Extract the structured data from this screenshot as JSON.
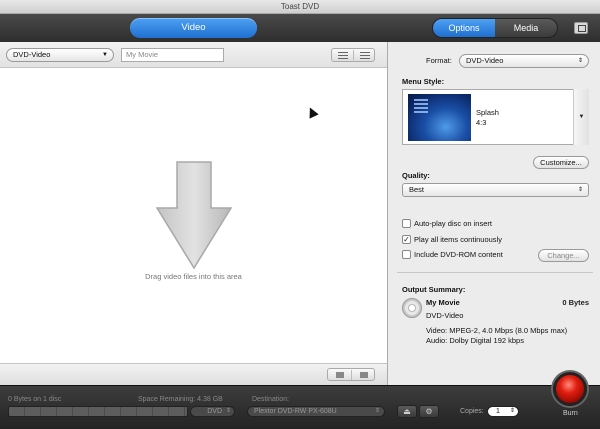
{
  "window": {
    "title": "Toast DVD"
  },
  "toolbar": {
    "video_label": "Video",
    "tabs": [
      {
        "label": "Options"
      },
      {
        "label": "Media"
      }
    ],
    "active_tab": "Options"
  },
  "left": {
    "format_select": "DVD-Video",
    "title_placeholder": "My Movie",
    "drop_hint": "Drag video files into this area"
  },
  "options": {
    "format_label": "Format:",
    "format_value": "DVD-Video",
    "menu_style_label": "Menu Style:",
    "menu_style_name": "Splash",
    "menu_style_ratio": "4:3",
    "customize_label": "Customize...",
    "quality_label": "Quality:",
    "quality_value": "Best",
    "checkboxes": [
      {
        "label": "Auto-play disc on insert",
        "checked": false
      },
      {
        "label": "Play all items continuously",
        "checked": true
      },
      {
        "label": "Include DVD-ROM content",
        "checked": false
      }
    ],
    "change_label": "Change...",
    "summary_label": "Output Summary:",
    "summary_name": "My Movie",
    "summary_size": "0 Bytes",
    "summary_format": "DVD-Video",
    "summary_video": "Video: MPEG-2, 4.0 Mbps (8.0 Mbps max)",
    "summary_audio": "Audio: Dolby Digital 192 kbps"
  },
  "status": {
    "bytes_on_disc": "0 Bytes on 1 disc",
    "space_remaining": "Space Remaining: 4.38 GB",
    "destination_label": "Destination:",
    "media_type": "DVD",
    "destination_value": "Plextor DVD-RW  PX-608U",
    "copies_label": "Copies:",
    "copies_value": "1",
    "burn_label": "Burn",
    "accent_color": "#1f6fd0",
    "burn_color": "#e01e10"
  }
}
